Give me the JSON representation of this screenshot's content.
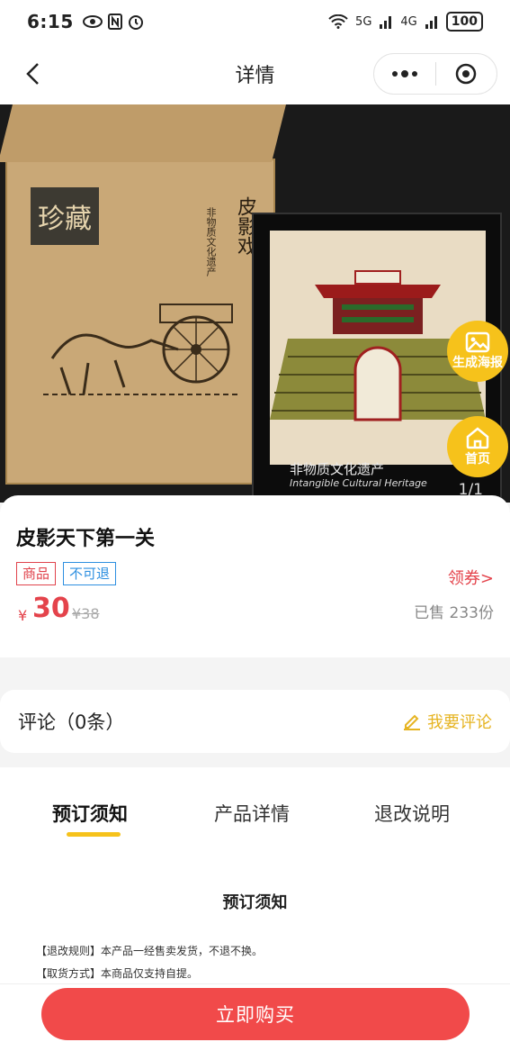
{
  "status": {
    "time": "6:15",
    "signal_5g": "5G",
    "signal_4g": "4G",
    "battery": "100"
  },
  "nav": {
    "title": "详情"
  },
  "hero": {
    "box_label": "珍藏",
    "box_title": "皮影戏",
    "box_subtitle": "非物质文化遗产",
    "frame_caption": "非物质文化遗产",
    "frame_caption_en": "Intangible Cultural Heritage",
    "counter": "1/1"
  },
  "fabs": {
    "poster_label": "生成海报",
    "home_label": "首页"
  },
  "product": {
    "name": "皮影天下第一关",
    "tags": [
      "商品",
      "不可退"
    ],
    "coupon": "领券>",
    "currency": "¥",
    "price": "30",
    "original_price": "¥38",
    "sold": "已售 233份"
  },
  "comments": {
    "title": "评论（0条）",
    "action": "我要评论"
  },
  "tabs": [
    "预订须知",
    "产品详情",
    "退改说明"
  ],
  "notice": {
    "title": "预订须知",
    "lines": [
      "【退改规则】本产品一经售卖发货，不退不换。",
      "【取货方式】本商品仅支持自提。"
    ]
  },
  "buy": {
    "label": "立即购买"
  },
  "colors": {
    "accent_red": "#f14a4a",
    "accent_yellow": "#f6c21b",
    "tag_blue": "#2d8fe0"
  }
}
